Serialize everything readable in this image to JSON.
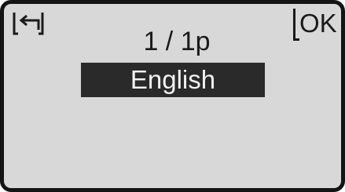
{
  "header": {
    "back_icon": "return-arrow-icon",
    "page_indicator": "1 / 1p",
    "ok_label": "OK"
  },
  "language_list": {
    "items": [
      {
        "label": "English",
        "selected": true
      }
    ]
  },
  "colors": {
    "screen_background": "#d8d8d8",
    "text": "#1a1a1a",
    "highlight_background": "#2a2a2a",
    "highlight_text": "#f2f2f2",
    "frame": "#141414"
  }
}
